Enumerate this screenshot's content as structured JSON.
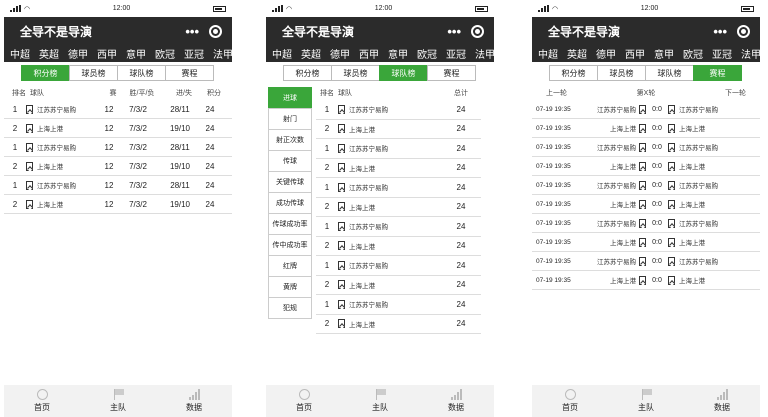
{
  "status": {
    "time": "12:00"
  },
  "app": {
    "title": "全导不是导演",
    "more": "•••"
  },
  "leagues": [
    "中超",
    "英超",
    "德甲",
    "西甲",
    "意甲",
    "欧冠",
    "亚冠",
    "法甲"
  ],
  "subtabs": [
    "积分榜",
    "球员榜",
    "球队榜",
    "赛程"
  ],
  "standings": {
    "headers": [
      "排名",
      "球队",
      "赛",
      "胜/平/负",
      "进/失",
      "积分"
    ],
    "rows": [
      {
        "rank": "1",
        "team": "江苏苏宁易购",
        "games": "12",
        "wdl": "7/3/2",
        "gd": "28/11",
        "pts": "24"
      },
      {
        "rank": "2",
        "team": "上海上港",
        "games": "12",
        "wdl": "7/3/2",
        "gd": "19/10",
        "pts": "24"
      },
      {
        "rank": "1",
        "team": "江苏苏宁易购",
        "games": "12",
        "wdl": "7/3/2",
        "gd": "28/11",
        "pts": "24"
      },
      {
        "rank": "2",
        "team": "上海上港",
        "games": "12",
        "wdl": "7/3/2",
        "gd": "19/10",
        "pts": "24"
      },
      {
        "rank": "1",
        "team": "江苏苏宁易购",
        "games": "12",
        "wdl": "7/3/2",
        "gd": "28/11",
        "pts": "24"
      },
      {
        "rank": "2",
        "team": "上海上港",
        "games": "12",
        "wdl": "7/3/2",
        "gd": "19/10",
        "pts": "24"
      }
    ]
  },
  "team_stats": {
    "categories": [
      "进球",
      "射门",
      "射正次数",
      "传球",
      "关键传球",
      "成功传球",
      "传球成功率",
      "传中成功率",
      "红牌",
      "黄牌",
      "犯规"
    ],
    "headers": [
      "排名",
      "球队",
      "总计"
    ],
    "rows": [
      {
        "rank": "1",
        "team": "江苏苏宁易购",
        "total": "24"
      },
      {
        "rank": "2",
        "team": "上海上港",
        "total": "24"
      },
      {
        "rank": "1",
        "team": "江苏苏宁易购",
        "total": "24"
      },
      {
        "rank": "2",
        "team": "上海上港",
        "total": "24"
      },
      {
        "rank": "1",
        "team": "江苏苏宁易购",
        "total": "24"
      },
      {
        "rank": "2",
        "team": "上海上港",
        "total": "24"
      },
      {
        "rank": "1",
        "team": "江苏苏宁易购",
        "total": "24"
      },
      {
        "rank": "2",
        "team": "上海上港",
        "total": "24"
      },
      {
        "rank": "1",
        "team": "江苏苏宁易购",
        "total": "24"
      },
      {
        "rank": "2",
        "team": "上海上港",
        "total": "24"
      },
      {
        "rank": "1",
        "team": "江苏苏宁易购",
        "total": "24"
      },
      {
        "rank": "2",
        "team": "上海上港",
        "total": "24"
      }
    ]
  },
  "schedule": {
    "prev": "上一轮",
    "round": "第X轮",
    "next": "下一轮",
    "rows": [
      {
        "time": "07-19 19:35",
        "home": "江苏苏宁易购",
        "score": "0:0",
        "away": "江苏苏宁易购"
      },
      {
        "time": "07-19 19:35",
        "home": "上海上港",
        "score": "0:0",
        "away": "上海上港"
      },
      {
        "time": "07-19 19:35",
        "home": "江苏苏宁易购",
        "score": "0:0",
        "away": "江苏苏宁易购"
      },
      {
        "time": "07-19 19:35",
        "home": "上海上港",
        "score": "0:0",
        "away": "上海上港"
      },
      {
        "time": "07-19 19:35",
        "home": "江苏苏宁易购",
        "score": "0:0",
        "away": "江苏苏宁易购"
      },
      {
        "time": "07-19 19:35",
        "home": "上海上港",
        "score": "0:0",
        "away": "上海上港"
      },
      {
        "time": "07-19 19:35",
        "home": "江苏苏宁易购",
        "score": "0:0",
        "away": "江苏苏宁易购"
      },
      {
        "time": "07-19 19:35",
        "home": "上海上港",
        "score": "0:0",
        "away": "上海上港"
      },
      {
        "time": "07-19 19:35",
        "home": "江苏苏宁易购",
        "score": "0:0",
        "away": "江苏苏宁易购"
      },
      {
        "time": "07-19 19:35",
        "home": "上海上港",
        "score": "0:0",
        "away": "上海上港"
      }
    ]
  },
  "nav": [
    {
      "label": "首页",
      "icon": "football-icon"
    },
    {
      "label": "主队",
      "icon": "flag-icon"
    },
    {
      "label": "数据",
      "icon": "stats-icon"
    }
  ],
  "colors": {
    "accent": "#3aa63a",
    "header": "#2b2b2b"
  }
}
